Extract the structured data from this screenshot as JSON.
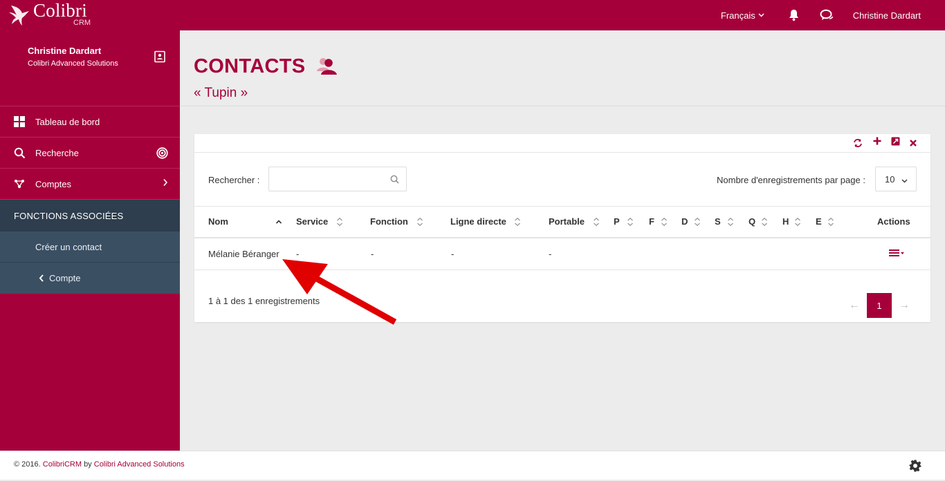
{
  "app": {
    "name": "Colibri",
    "sub": "CRM"
  },
  "topbar": {
    "language": "Français",
    "user": "Christine Dardart",
    "icons": [
      "bell-icon",
      "chat-icon"
    ]
  },
  "sidebar": {
    "user_name": "Christine Dardart",
    "user_org": "Colibri Advanced Solutions",
    "items": [
      {
        "label": "Tableau de bord",
        "icon": "dashboard-icon"
      },
      {
        "label": "Recherche",
        "icon": "search-icon"
      },
      {
        "label": "Comptes",
        "icon": "accounts-icon"
      }
    ],
    "section_title": "FONCTIONS ASSOCIÉES",
    "sub_items": [
      {
        "label": "Créer un contact"
      },
      {
        "label": "Compte"
      }
    ]
  },
  "header": {
    "title": "CONTACTS",
    "subtitle": "« Tupin »"
  },
  "table_controls": {
    "search_label": "Rechercher :",
    "search_value": "",
    "per_page_label": "Nombre d'enregistrements par page :",
    "per_page_value": "10"
  },
  "table": {
    "columns": [
      "Nom",
      "Service",
      "Fonction",
      "Ligne directe",
      "Portable",
      "P",
      "F",
      "D",
      "S",
      "Q",
      "H",
      "E",
      "Actions"
    ],
    "rows": [
      {
        "nom": "Mélanie Béranger",
        "service": "-",
        "fonction": "-",
        "ligne_directe": "-",
        "portable": "-"
      }
    ]
  },
  "pagination": {
    "info": "1 à 1 des 1 enregistrements",
    "prev": "←",
    "current": "1",
    "next": "→"
  },
  "footer": {
    "copy": "© 2016.",
    "brand": "ColibriCRM",
    "by": "by",
    "company": "Colibri Advanced Solutions"
  },
  "colors": {
    "primary": "#a6003a",
    "sidebar_section": "#2e3e4e",
    "sidebar_sub": "#3b4f63",
    "annotation": "#e00000"
  }
}
